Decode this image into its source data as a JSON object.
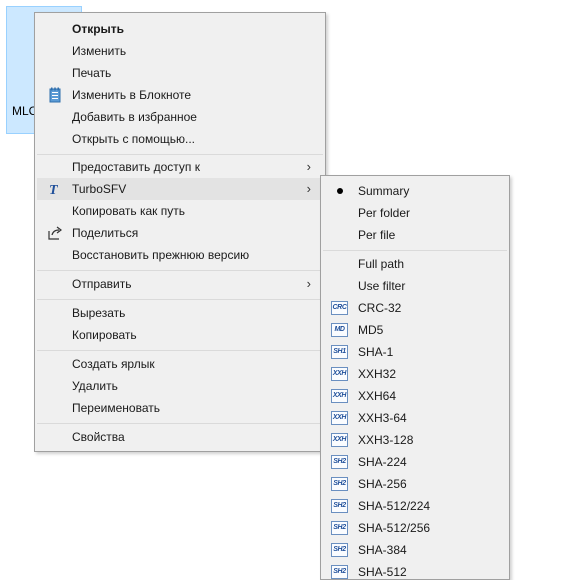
{
  "file": {
    "name": "MLC"
  },
  "context_menu": {
    "open": "Открыть",
    "edit": "Изменить",
    "print": "Печать",
    "edit_notepad": "Изменить в Блокноте",
    "add_favorites": "Добавить в избранное",
    "open_with": "Открыть с помощью...",
    "give_access": "Предоставить доступ к",
    "turbosfv": "TurboSFV",
    "copy_path": "Копировать как путь",
    "share": "Поделиться",
    "restore_versions": "Восстановить прежнюю версию",
    "send_to": "Отправить",
    "cut": "Вырезать",
    "copy": "Копировать",
    "create_shortcut": "Создать ярлык",
    "delete": "Удалить",
    "rename": "Переименовать",
    "properties": "Свойства"
  },
  "turbosfv_menu": {
    "summary": "Summary",
    "per_folder": "Per folder",
    "per_file": "Per file",
    "full_path": "Full path",
    "use_filter": "Use filter",
    "hashes": [
      {
        "label": "CRC-32",
        "icon": "CRC"
      },
      {
        "label": "MD5",
        "icon": "MD"
      },
      {
        "label": "SHA-1",
        "icon": "SH1"
      },
      {
        "label": "XXH32",
        "icon": "XXH"
      },
      {
        "label": "XXH64",
        "icon": "XXH"
      },
      {
        "label": "XXH3-64",
        "icon": "XXH"
      },
      {
        "label": "XXH3-128",
        "icon": "XXH"
      },
      {
        "label": "SHA-224",
        "icon": "SH2"
      },
      {
        "label": "SHA-256",
        "icon": "SH2"
      },
      {
        "label": "SHA-512/224",
        "icon": "SH2"
      },
      {
        "label": "SHA-512/256",
        "icon": "SH2"
      },
      {
        "label": "SHA-384",
        "icon": "SH2"
      },
      {
        "label": "SHA-512",
        "icon": "SH2"
      }
    ]
  }
}
